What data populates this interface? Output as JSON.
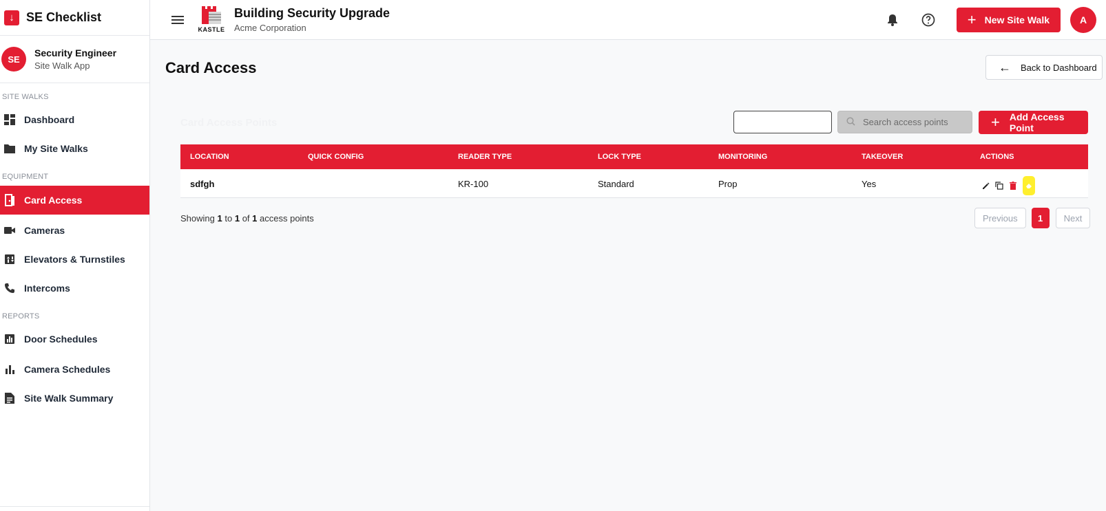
{
  "app": {
    "title": "SE Checklist"
  },
  "user": {
    "initials": "SE",
    "name": "Security Engineer",
    "role": "Site Walk App"
  },
  "sidebar": {
    "sections": [
      {
        "label": "SITE WALKS",
        "items": [
          {
            "label": "Dashboard",
            "icon": "dashboard-icon"
          },
          {
            "label": "My Site Walks",
            "icon": "folder-icon"
          }
        ]
      },
      {
        "label": "EQUIPMENT",
        "items": [
          {
            "label": "Card Access",
            "icon": "door-icon",
            "active": true
          },
          {
            "label": "Cameras",
            "icon": "video-camera-icon"
          },
          {
            "label": "Elevators & Turnstiles",
            "icon": "elevator-icon"
          },
          {
            "label": "Intercoms",
            "icon": "phone-icon"
          }
        ]
      },
      {
        "label": "REPORTS",
        "items": [
          {
            "label": "Door Schedules",
            "icon": "bar-chart-icon"
          },
          {
            "label": "Camera Schedules",
            "icon": "bar-chart-icon"
          },
          {
            "label": "Site Walk Summary",
            "icon": "summary-icon"
          }
        ]
      }
    ]
  },
  "header": {
    "logo_text": "KASTLE",
    "project_title": "Building Security Upgrade",
    "project_client": "Acme Corporation",
    "new_site_walk_label": "New Site Walk",
    "avatar_initial": "A"
  },
  "page": {
    "title": "Card Access",
    "back_label": "Back to Dashboard",
    "card_title": "Card Access Points",
    "search_placeholder": "Search access points",
    "add_label": "Add Access Point"
  },
  "table": {
    "columns": [
      "LOCATION",
      "QUICK CONFIG",
      "READER TYPE",
      "LOCK TYPE",
      "MONITORING",
      "TAKEOVER",
      "ACTIONS"
    ],
    "rows": [
      {
        "location": "sdfgh",
        "quick_config": "",
        "reader_type": "KR-100",
        "lock_type": "Standard",
        "monitoring": "Prop",
        "takeover": "Yes"
      }
    ]
  },
  "pagination": {
    "showing_prefix": "Showing",
    "from": "1",
    "to_word": "to",
    "to": "1",
    "of_word": "of",
    "total": "1",
    "suffix": "access points",
    "previous": "Previous",
    "current": "1",
    "next": "Next"
  },
  "colors": {
    "accent": "#e31e32",
    "highlight": "#ffef2e"
  }
}
